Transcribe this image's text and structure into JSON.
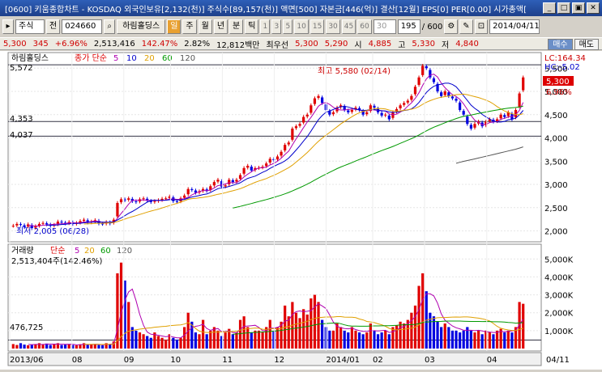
{
  "window": {
    "title": "[0600] 키움종합차트 - KOSDAQ 외국인보유[2,132(천)] 주식수[89,157(천)] 액면[500] 자본금[446(억)] 결산[12월] EPS[0] PER[0.00] 시가총액[",
    "min_label": "_",
    "restore_label": "□",
    "max_label": "▣",
    "close_label": "✕"
  },
  "toolbar": {
    "stock_type": "주식",
    "mode_label": "전",
    "code": "024660",
    "stock_name": "하림홀딩스",
    "period_buttons": [
      "일",
      "주",
      "월",
      "년",
      "분",
      "틱"
    ],
    "minute_buttons": [
      "1",
      "3",
      "5",
      "10",
      "15",
      "30",
      "45",
      "60"
    ],
    "interval_value": "30",
    "count_value": "195",
    "count_total": "/ 600",
    "date_value": "2014/04/11"
  },
  "infobar": {
    "price": "5,300",
    "change": "345",
    "change_pct": "+6.96%",
    "volume": "2,513,416",
    "volume_ratio": "142.47%",
    "turnover": "2.82%",
    "amount": "12,812백만",
    "label_best": "최우선",
    "best_ask": "5,300",
    "best_bid": "5,290",
    "open_label": "시",
    "open": "4,885",
    "high_label": "고",
    "high": "5,330",
    "low_label": "저",
    "low": "4,840",
    "tab_sell": "매수",
    "tab_buy": "매도"
  },
  "price_panel": {
    "legend_name": "하림홀딩스",
    "legend_type": "종가 단순",
    "ma_periods": [
      "5",
      "10",
      "20",
      "60",
      "120"
    ],
    "ma_colors": [
      "#b000b0",
      "#0000cc",
      "#e0a000",
      "#009900",
      "#555555"
    ],
    "yaxis_labels": [
      "5,500",
      "5,000",
      "4,500",
      "4,000",
      "3,500",
      "3,000",
      "2,500",
      "2,000"
    ],
    "lc_label": "LC:164.34",
    "hc_label": "HC:-5.02",
    "current_price_label": "5,300",
    "current_pct_label": "6.96%",
    "hline_top": "5,572",
    "hline_mid": "4,353",
    "hline_low": "4,037",
    "max_annotation": "최고 5,580 (02/14)",
    "min_annotation": "최저 2,005 (06/28)"
  },
  "volume_panel": {
    "legend_name": "거래량",
    "legend_type": "단순",
    "ma_periods": [
      "5",
      "20",
      "60",
      "120"
    ],
    "current_volume": "2,513,404주(142.46%)",
    "baseline_label": "476,725",
    "yaxis_labels": [
      "5,000K",
      "4,000K",
      "3,000K",
      "2,000K",
      "1,000K"
    ]
  },
  "xaxis": {
    "labels": [
      "2013/06",
      "08",
      "09",
      "10",
      "11",
      "12",
      "2014/01",
      "02",
      "03",
      "04"
    ],
    "end_label": "04/11"
  },
  "chart_data": {
    "type": "candlestick",
    "x_range": [
      "2013/06",
      "2014/04/11"
    ],
    "ylim": [
      1800,
      5800
    ],
    "price_series": [
      2110,
      2150,
      2130,
      2080,
      2140,
      2060,
      2100,
      2150,
      2170,
      2140,
      2110,
      2130,
      2200,
      2180,
      2160,
      2190,
      2150,
      2170,
      2210,
      2240,
      2180,
      2200,
      2230,
      2160,
      2150,
      2190,
      2160,
      2240,
      2600,
      2680,
      2660,
      2700,
      2640,
      2620,
      2680,
      2700,
      2650,
      2620,
      2640,
      2660,
      2690,
      2700,
      2740,
      2640,
      2620,
      2700,
      2760,
      2900,
      2880,
      2820,
      2850,
      2900,
      2860,
      2960,
      3050,
      3100,
      2950,
      2980,
      3100,
      3050,
      3100,
      3200,
      3350,
      3400,
      3300,
      3350,
      3360,
      3380,
      3450,
      3550,
      3520,
      3600,
      3700,
      3850,
      3900,
      4200,
      4250,
      4300,
      4450,
      4500,
      4700,
      4850,
      4900,
      4750,
      4600,
      4500,
      4550,
      4650,
      4700,
      4600,
      4550,
      4600,
      4650,
      4600,
      4500,
      4550,
      4700,
      4650,
      4550,
      4480,
      4500,
      4400,
      4550,
      4620,
      4700,
      4750,
      4800,
      4900,
      5100,
      5300,
      5550,
      5500,
      5300,
      5200,
      5000,
      4900,
      5000,
      4900,
      4850,
      4800,
      4600,
      4500,
      4300,
      4200,
      4300,
      4350,
      4250,
      4350,
      4400,
      4350,
      4400,
      4500,
      4450,
      4550,
      4400,
      4600,
      4955,
      5300
    ],
    "volume_series": [
      0.25,
      0.2,
      0.3,
      0.22,
      0.18,
      0.2,
      0.25,
      0.3,
      0.22,
      0.28,
      0.2,
      0.25,
      0.3,
      0.2,
      0.22,
      0.25,
      0.2,
      0.18,
      0.24,
      0.3,
      0.2,
      0.22,
      0.25,
      0.2,
      0.18,
      0.3,
      0.25,
      0.4,
      4.2,
      4.8,
      3.8,
      2.6,
      1.2,
      1.0,
      0.9,
      0.8,
      0.7,
      0.6,
      0.9,
      0.7,
      0.6,
      0.5,
      0.8,
      0.6,
      0.5,
      0.6,
      1.2,
      2.0,
      1.5,
      0.9,
      0.8,
      1.6,
      0.8,
      1.0,
      1.2,
      1.0,
      0.7,
      0.9,
      1.1,
      0.8,
      0.9,
      1.6,
      1.8,
      1.2,
      0.9,
      1.0,
      1.0,
      0.9,
      1.2,
      1.6,
      1.0,
      1.2,
      1.5,
      2.4,
      1.8,
      2.6,
      2.0,
      1.7,
      2.2,
      1.9,
      2.8,
      3.0,
      2.6,
      1.6,
      1.2,
      1.0,
      1.0,
      1.4,
      1.2,
      1.0,
      0.9,
      1.2,
      1.0,
      0.9,
      0.8,
      0.9,
      1.4,
      1.0,
      0.8,
      0.9,
      1.0,
      0.8,
      1.2,
      1.3,
      1.5,
      1.4,
      1.6,
      2.0,
      2.4,
      3.5,
      4.2,
      3.2,
      2.0,
      1.8,
      1.5,
      1.2,
      1.4,
      1.2,
      1.0,
      1.0,
      0.9,
      1.0,
      1.2,
      1.0,
      0.9,
      1.0,
      0.8,
      1.0,
      0.9,
      0.8,
      1.0,
      1.1,
      0.9,
      1.0,
      0.9,
      1.2,
      2.6,
      2.5
    ],
    "volume_unit": "K"
  }
}
